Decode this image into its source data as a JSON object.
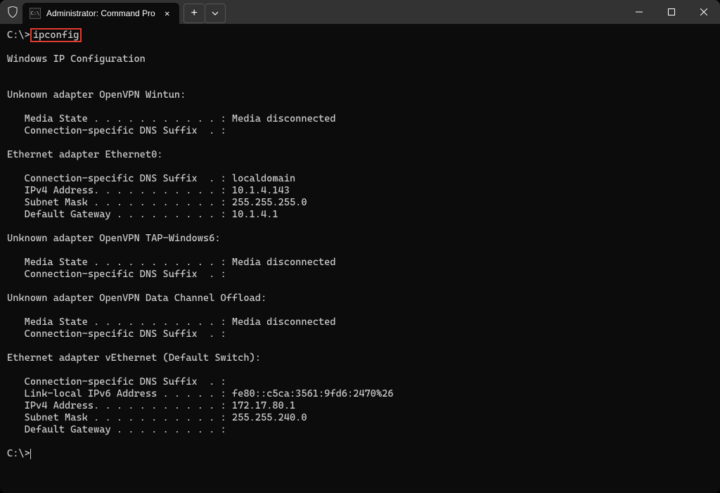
{
  "titlebar": {
    "tab_title": "Administrator: Command Pro",
    "tab_icon_text": "C:\\",
    "close_label": "✕",
    "new_tab_label": "+",
    "dropdown_label": "⌄"
  },
  "terminal": {
    "prompt1_prefix": "C:\\>",
    "command": "ipconfig",
    "blank1": "",
    "header": "Windows IP Configuration",
    "blank2": "",
    "blank3": "",
    "adapter1_title": "Unknown adapter OpenVPN Wintun:",
    "blank4": "",
    "adapter1_line1": "   Media State . . . . . . . . . . . : Media disconnected",
    "adapter1_line2": "   Connection-specific DNS Suffix  . :",
    "blank5": "",
    "adapter2_title": "Ethernet adapter Ethernet0:",
    "blank6": "",
    "adapter2_line1": "   Connection-specific DNS Suffix  . : localdomain",
    "adapter2_line2": "   IPv4 Address. . . . . . . . . . . : 10.1.4.143",
    "adapter2_line3": "   Subnet Mask . . . . . . . . . . . : 255.255.255.0",
    "adapter2_line4": "   Default Gateway . . . . . . . . . : 10.1.4.1",
    "blank7": "",
    "adapter3_title": "Unknown adapter OpenVPN TAP-Windows6:",
    "blank8": "",
    "adapter3_line1": "   Media State . . . . . . . . . . . : Media disconnected",
    "adapter3_line2": "   Connection-specific DNS Suffix  . :",
    "blank9": "",
    "adapter4_title": "Unknown adapter OpenVPN Data Channel Offload:",
    "blank10": "",
    "adapter4_line1": "   Media State . . . . . . . . . . . : Media disconnected",
    "adapter4_line2": "   Connection-specific DNS Suffix  . :",
    "blank11": "",
    "adapter5_title": "Ethernet adapter vEthernet (Default Switch):",
    "blank12": "",
    "adapter5_line1": "   Connection-specific DNS Suffix  . :",
    "adapter5_line2": "   Link-local IPv6 Address . . . . . : fe80::c5ca:3561:9fd6:2470%26",
    "adapter5_line3": "   IPv4 Address. . . . . . . . . . . : 172.17.80.1",
    "adapter5_line4": "   Subnet Mask . . . . . . . . . . . : 255.255.240.0",
    "adapter5_line5": "   Default Gateway . . . . . . . . . :",
    "blank13": "",
    "prompt2": "C:\\>"
  }
}
